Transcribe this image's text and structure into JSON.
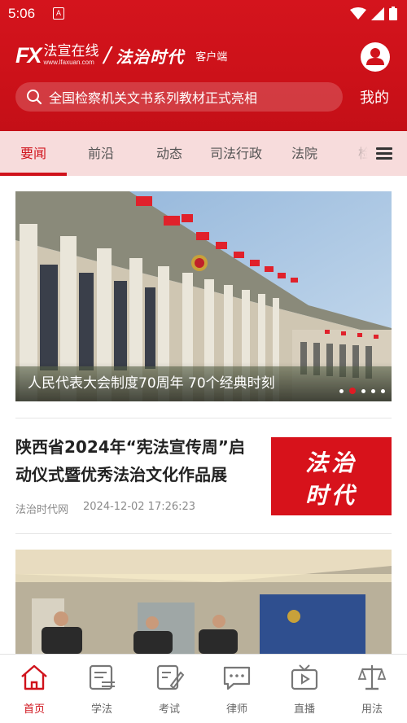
{
  "statusbar": {
    "time": "5:06",
    "notif_glyph": "A"
  },
  "header": {
    "brand_logo": "FX",
    "brand_name": "法宣在线",
    "brand_url": "www.lfaxuan.com",
    "brand_era": "法治时代",
    "brand_client": "客户端",
    "mine_label": "我的",
    "search_text": "全国检察机关文书系列教材正式亮相"
  },
  "tabs": [
    {
      "label": "要闻"
    },
    {
      "label": "前沿"
    },
    {
      "label": "动态"
    },
    {
      "label": "司法行政"
    },
    {
      "label": "法院"
    },
    {
      "label": "检"
    }
  ],
  "hero": {
    "caption": "人民代表大会制度70周年 70个经典时刻",
    "slide_count": 5,
    "active_slide": 1
  },
  "article": {
    "title": "陕西省2024年“宪法宣传周”启动仪式暨优秀法治文化作品展",
    "source": "法治时代网",
    "date": "2024-12-02 17:26:23",
    "thumb_line1": "法治",
    "thumb_line2": "时代"
  },
  "bottom_nav": [
    {
      "label": "首页",
      "icon": "home-icon"
    },
    {
      "label": "学法",
      "icon": "study-icon"
    },
    {
      "label": "考试",
      "icon": "exam-icon"
    },
    {
      "label": "律师",
      "icon": "lawyer-chat-icon"
    },
    {
      "label": "直播",
      "icon": "live-tv-icon"
    },
    {
      "label": "用法",
      "icon": "scales-icon"
    }
  ],
  "colors": {
    "brand_red": "#d0121b",
    "tab_bg": "#f7dcdc"
  }
}
